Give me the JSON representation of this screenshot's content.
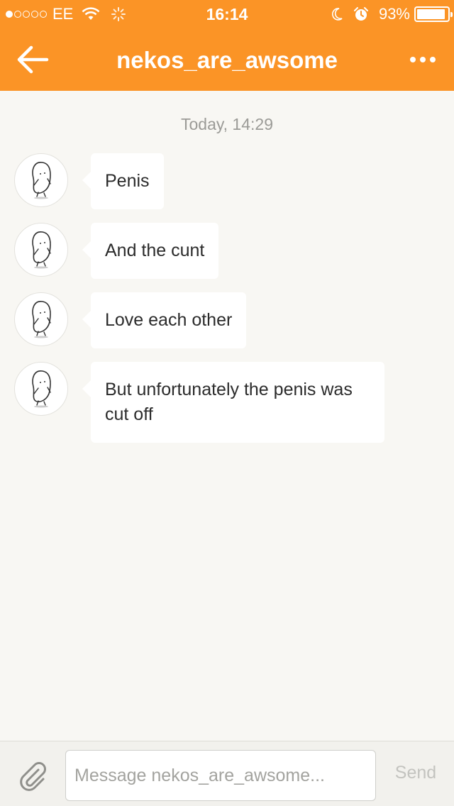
{
  "status_bar": {
    "carrier": "EE",
    "time": "16:14",
    "battery": "93%",
    "battery_level": 0.93,
    "signal_strength": 1
  },
  "header": {
    "title": "nekos_are_awsome",
    "back_icon": "arrow-left-icon",
    "more_icon": "more-dots-icon"
  },
  "conversation": {
    "timestamp": "Today, 14:29",
    "messages": [
      {
        "text": "Penis"
      },
      {
        "text": "And the cunt"
      },
      {
        "text": "Love each other"
      },
      {
        "text": "But unfortunately the penis was cut off"
      }
    ]
  },
  "composer": {
    "placeholder": "Message nekos_are_awsome...",
    "value": "",
    "send_label": "Send",
    "attach_icon": "paperclip-icon"
  },
  "colors": {
    "accent": "#fb9426",
    "background": "#f8f7f3",
    "bubble": "#ffffff"
  }
}
